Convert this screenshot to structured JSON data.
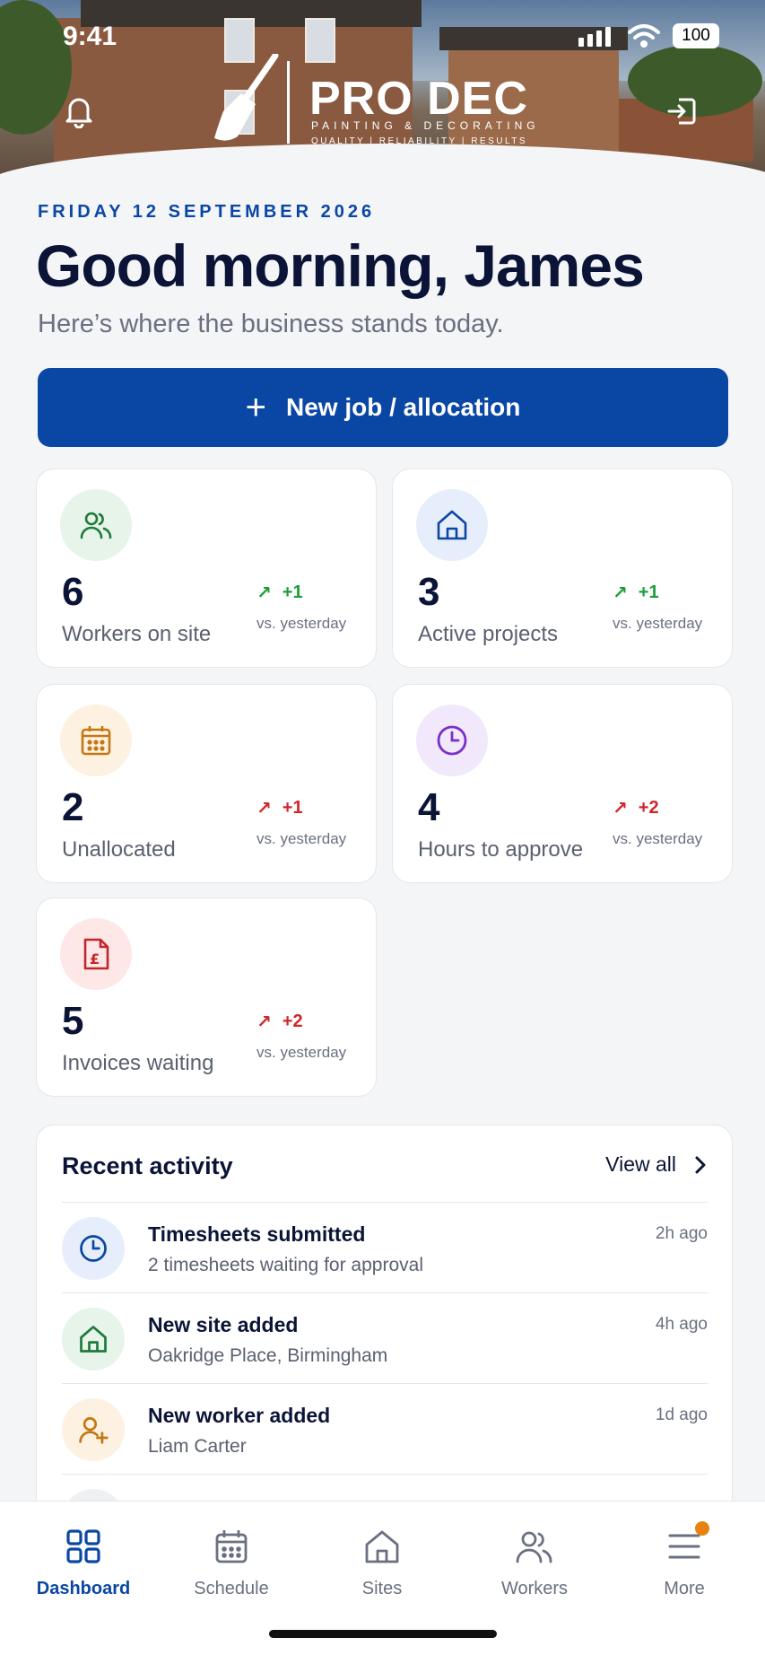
{
  "status_bar": {
    "time": "9:41",
    "battery": "100"
  },
  "header": {
    "logo_name": "PRO DEC",
    "logo_sub": "PAINTING & DECORATING",
    "logo_tagline": "QUALITY | RELIABILITY | RESULTS"
  },
  "greeting": {
    "date": "FRIDAY 12 SEPTEMBER 2026",
    "title": "Good morning, James",
    "subtitle": "Here’s where the business stands today."
  },
  "cta": {
    "label": "New job / allocation"
  },
  "stats": [
    {
      "value": "6",
      "label": "Workers on site",
      "trend": "+1",
      "trend_note": "vs. yesterday",
      "icon": "users-icon",
      "trend_color": "#1f9d3a",
      "icon_bg": "#e6f4ea",
      "icon_color": "#1f7a3a"
    },
    {
      "value": "3",
      "label": "Active projects",
      "trend": "+1",
      "trend_note": "vs. yesterday",
      "icon": "home-icon",
      "trend_color": "#1f9d3a",
      "icon_bg": "#e7eefb",
      "icon_color": "#0a47a5"
    },
    {
      "value": "2",
      "label": "Unallocated",
      "trend": "+1",
      "trend_note": "vs. yesterday",
      "icon": "calendar-icon",
      "trend_color": "#d0262a",
      "icon_bg": "#fdf1e1",
      "icon_color": "#c47814"
    },
    {
      "value": "4",
      "label": "Hours to approve",
      "trend": "+2",
      "trend_note": "vs. yesterday",
      "icon": "clock-icon",
      "trend_color": "#d0262a",
      "icon_bg": "#f1e9fb",
      "icon_color": "#7a2fc7"
    },
    {
      "value": "5",
      "label": "Invoices waiting",
      "trend": "+2",
      "trend_note": "vs. yesterday",
      "icon": "invoice-icon",
      "trend_color": "#d0262a",
      "icon_bg": "#fde7e7",
      "icon_color": "#c3262a"
    }
  ],
  "activity": {
    "title": "Recent activity",
    "view_all": "View all",
    "items": [
      {
        "title": "Timesheets submitted",
        "subtitle": "2 timesheets waiting for approval",
        "ago": "2h ago",
        "icon": "clock-icon"
      },
      {
        "title": "New site added",
        "subtitle": "Oakridge Place, Birmingham",
        "ago": "4h ago",
        "icon": "home-icon"
      },
      {
        "title": "New worker added",
        "subtitle": "Liam Carter",
        "ago": "1d ago",
        "icon": "add-user-icon"
      }
    ]
  },
  "tabs": [
    {
      "label": "Dashboard",
      "icon": "grid-icon",
      "active": true
    },
    {
      "label": "Schedule",
      "icon": "calendar-icon"
    },
    {
      "label": "Sites",
      "icon": "home-icon"
    },
    {
      "label": "Workers",
      "icon": "users-icon"
    },
    {
      "label": "More",
      "icon": "menu-icon"
    }
  ],
  "colors": {
    "primary": "#0a47a5",
    "text": "#0b1437",
    "muted": "#6a7080",
    "up_good": "#1f9d3a",
    "up_bad": "#d0262a"
  }
}
